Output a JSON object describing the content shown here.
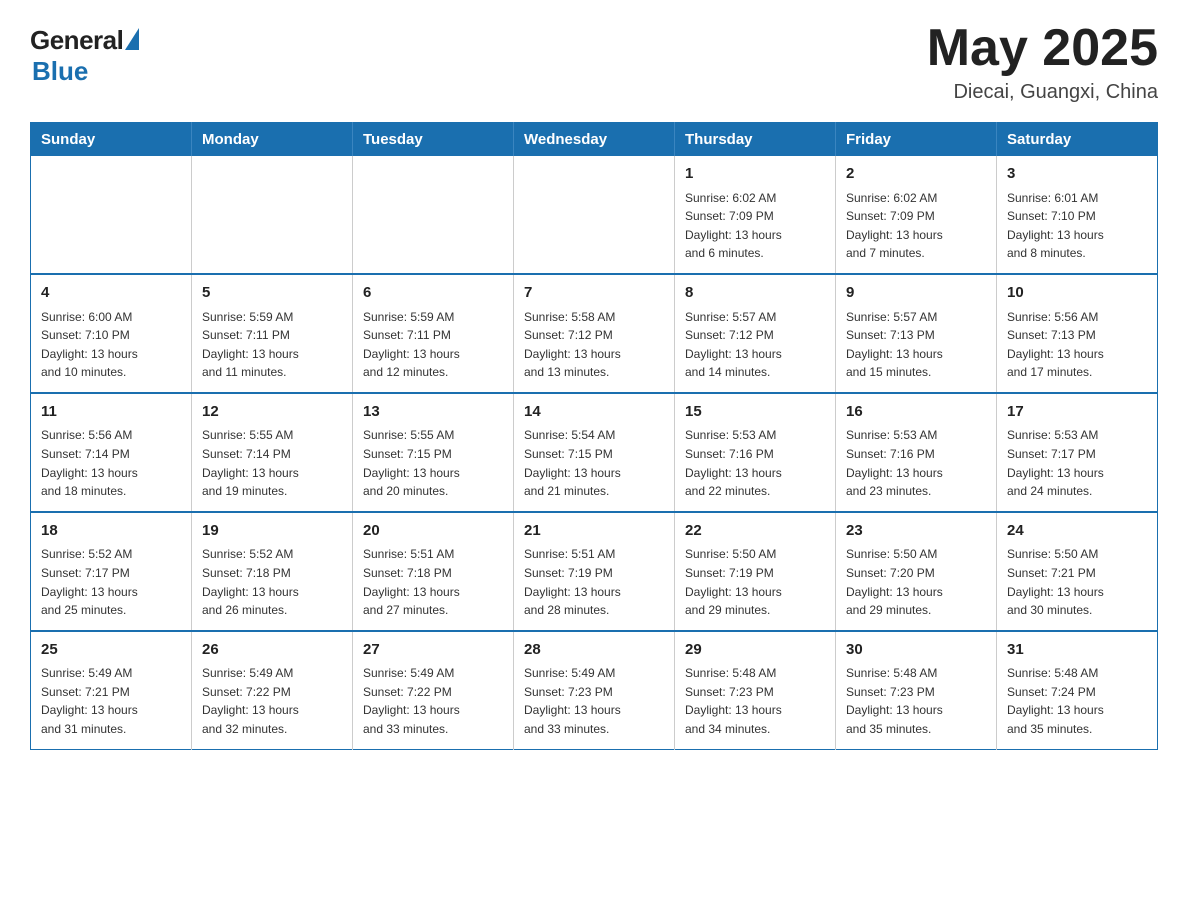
{
  "header": {
    "logo_general": "General",
    "logo_blue": "Blue",
    "month_title": "May 2025",
    "location": "Diecai, Guangxi, China"
  },
  "days_of_week": [
    "Sunday",
    "Monday",
    "Tuesday",
    "Wednesday",
    "Thursday",
    "Friday",
    "Saturday"
  ],
  "weeks": [
    [
      {
        "day": "",
        "info": ""
      },
      {
        "day": "",
        "info": ""
      },
      {
        "day": "",
        "info": ""
      },
      {
        "day": "",
        "info": ""
      },
      {
        "day": "1",
        "info": "Sunrise: 6:02 AM\nSunset: 7:09 PM\nDaylight: 13 hours\nand 6 minutes."
      },
      {
        "day": "2",
        "info": "Sunrise: 6:02 AM\nSunset: 7:09 PM\nDaylight: 13 hours\nand 7 minutes."
      },
      {
        "day": "3",
        "info": "Sunrise: 6:01 AM\nSunset: 7:10 PM\nDaylight: 13 hours\nand 8 minutes."
      }
    ],
    [
      {
        "day": "4",
        "info": "Sunrise: 6:00 AM\nSunset: 7:10 PM\nDaylight: 13 hours\nand 10 minutes."
      },
      {
        "day": "5",
        "info": "Sunrise: 5:59 AM\nSunset: 7:11 PM\nDaylight: 13 hours\nand 11 minutes."
      },
      {
        "day": "6",
        "info": "Sunrise: 5:59 AM\nSunset: 7:11 PM\nDaylight: 13 hours\nand 12 minutes."
      },
      {
        "day": "7",
        "info": "Sunrise: 5:58 AM\nSunset: 7:12 PM\nDaylight: 13 hours\nand 13 minutes."
      },
      {
        "day": "8",
        "info": "Sunrise: 5:57 AM\nSunset: 7:12 PM\nDaylight: 13 hours\nand 14 minutes."
      },
      {
        "day": "9",
        "info": "Sunrise: 5:57 AM\nSunset: 7:13 PM\nDaylight: 13 hours\nand 15 minutes."
      },
      {
        "day": "10",
        "info": "Sunrise: 5:56 AM\nSunset: 7:13 PM\nDaylight: 13 hours\nand 17 minutes."
      }
    ],
    [
      {
        "day": "11",
        "info": "Sunrise: 5:56 AM\nSunset: 7:14 PM\nDaylight: 13 hours\nand 18 minutes."
      },
      {
        "day": "12",
        "info": "Sunrise: 5:55 AM\nSunset: 7:14 PM\nDaylight: 13 hours\nand 19 minutes."
      },
      {
        "day": "13",
        "info": "Sunrise: 5:55 AM\nSunset: 7:15 PM\nDaylight: 13 hours\nand 20 minutes."
      },
      {
        "day": "14",
        "info": "Sunrise: 5:54 AM\nSunset: 7:15 PM\nDaylight: 13 hours\nand 21 minutes."
      },
      {
        "day": "15",
        "info": "Sunrise: 5:53 AM\nSunset: 7:16 PM\nDaylight: 13 hours\nand 22 minutes."
      },
      {
        "day": "16",
        "info": "Sunrise: 5:53 AM\nSunset: 7:16 PM\nDaylight: 13 hours\nand 23 minutes."
      },
      {
        "day": "17",
        "info": "Sunrise: 5:53 AM\nSunset: 7:17 PM\nDaylight: 13 hours\nand 24 minutes."
      }
    ],
    [
      {
        "day": "18",
        "info": "Sunrise: 5:52 AM\nSunset: 7:17 PM\nDaylight: 13 hours\nand 25 minutes."
      },
      {
        "day": "19",
        "info": "Sunrise: 5:52 AM\nSunset: 7:18 PM\nDaylight: 13 hours\nand 26 minutes."
      },
      {
        "day": "20",
        "info": "Sunrise: 5:51 AM\nSunset: 7:18 PM\nDaylight: 13 hours\nand 27 minutes."
      },
      {
        "day": "21",
        "info": "Sunrise: 5:51 AM\nSunset: 7:19 PM\nDaylight: 13 hours\nand 28 minutes."
      },
      {
        "day": "22",
        "info": "Sunrise: 5:50 AM\nSunset: 7:19 PM\nDaylight: 13 hours\nand 29 minutes."
      },
      {
        "day": "23",
        "info": "Sunrise: 5:50 AM\nSunset: 7:20 PM\nDaylight: 13 hours\nand 29 minutes."
      },
      {
        "day": "24",
        "info": "Sunrise: 5:50 AM\nSunset: 7:21 PM\nDaylight: 13 hours\nand 30 minutes."
      }
    ],
    [
      {
        "day": "25",
        "info": "Sunrise: 5:49 AM\nSunset: 7:21 PM\nDaylight: 13 hours\nand 31 minutes."
      },
      {
        "day": "26",
        "info": "Sunrise: 5:49 AM\nSunset: 7:22 PM\nDaylight: 13 hours\nand 32 minutes."
      },
      {
        "day": "27",
        "info": "Sunrise: 5:49 AM\nSunset: 7:22 PM\nDaylight: 13 hours\nand 33 minutes."
      },
      {
        "day": "28",
        "info": "Sunrise: 5:49 AM\nSunset: 7:23 PM\nDaylight: 13 hours\nand 33 minutes."
      },
      {
        "day": "29",
        "info": "Sunrise: 5:48 AM\nSunset: 7:23 PM\nDaylight: 13 hours\nand 34 minutes."
      },
      {
        "day": "30",
        "info": "Sunrise: 5:48 AM\nSunset: 7:23 PM\nDaylight: 13 hours\nand 35 minutes."
      },
      {
        "day": "31",
        "info": "Sunrise: 5:48 AM\nSunset: 7:24 PM\nDaylight: 13 hours\nand 35 minutes."
      }
    ]
  ]
}
